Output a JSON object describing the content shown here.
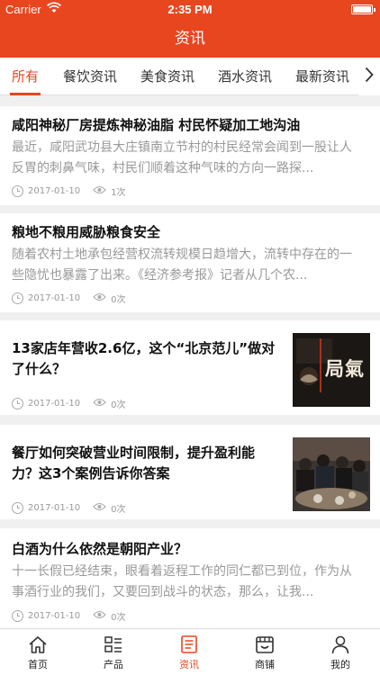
{
  "status": {
    "carrier": "Carrier",
    "time": "2:35 PM"
  },
  "header": {
    "title": "资讯"
  },
  "tabs": [
    {
      "label": "所有",
      "active": true
    },
    {
      "label": "餐饮资讯"
    },
    {
      "label": "美食资讯"
    },
    {
      "label": "酒水资讯"
    },
    {
      "label": "最新资讯"
    }
  ],
  "articles": [
    {
      "title": "咸阳神秘厂房提炼神秘油脂 村民怀疑加工地沟油",
      "desc_line1": "最近，咸阳武功县大庄镇南立节村的村民经常会闻到一股让人",
      "desc_line2": "反胃的刺鼻气味，村民们顺着这种气味的方向一路探...",
      "date": "2017-01-10",
      "views": "1次"
    },
    {
      "title": "粮地不粮用威胁粮食安全",
      "desc_line1": "随着农村土地承包经营权流转规模日趋增大，流转中存在的一",
      "desc_line2": "些隐忧也暴露了出来。《经济参考报》记者从几个农...",
      "date": "2017-01-10",
      "views": "0次"
    },
    {
      "title_line1": "13家店年营收2.6亿，这个“北京范儿”做对",
      "title_line2": "了什么？",
      "date": "2017-01-10",
      "views": "0次",
      "thumb_text": "局氣"
    },
    {
      "title_line1": "餐厅如何突破营业时间限制，提升盈利能",
      "title_line2": "力？这3个案例告诉你答案",
      "date": "2017-01-10",
      "views": "0次"
    },
    {
      "title": "白酒为什么依然是朝阳产业？",
      "desc_line1": "十一长假已经结束，眼看着返程工作的同仁都已到位，作为从",
      "desc_line2": "事酒行业的我们，又要回到战斗的状态，那么，让我...",
      "date": "2017-01-10",
      "views": "0次"
    }
  ],
  "tabbar": [
    {
      "label": "首页",
      "icon": "home-icon"
    },
    {
      "label": "产品",
      "icon": "list-icon"
    },
    {
      "label": "资讯",
      "icon": "news-icon",
      "active": true
    },
    {
      "label": "商铺",
      "icon": "store-icon"
    },
    {
      "label": "我的",
      "icon": "user-icon"
    }
  ],
  "colors": {
    "accent": "#e8461e"
  }
}
